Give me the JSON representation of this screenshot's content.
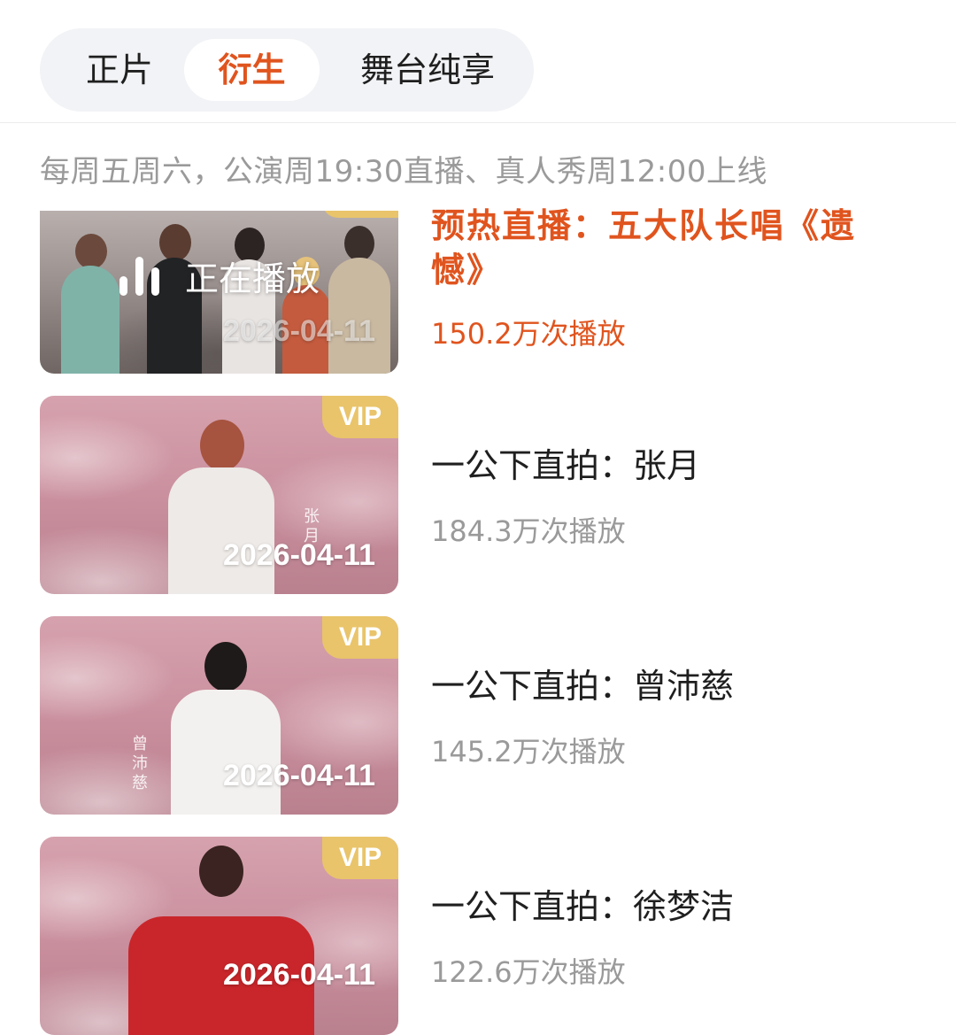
{
  "tabs": [
    {
      "label": "正片",
      "selected": false
    },
    {
      "label": "衍生",
      "selected": true
    },
    {
      "label": "舞台纯享",
      "selected": false
    }
  ],
  "colors": {
    "accent": "#e0541e",
    "vip": "#e9c46a",
    "muted": "#9a9a9a",
    "tab_bg": "#f2f3f6"
  },
  "schedule_note": "每周五周六，公演周19:30直播、真人秀周12:00上线",
  "videos": [
    {
      "title": "预热直播：五大队长唱《遗憾》",
      "plays": "150.2万次播放",
      "date": "2026-04-11",
      "status": "正在播放",
      "status_icon": "playing-bars-icon",
      "vip": false,
      "active": true
    },
    {
      "title": "一公下直拍：张月",
      "plays": "184.3万次播放",
      "date": "2026-04-11",
      "badge": "VIP",
      "thumb_text": "张月",
      "vip": true,
      "active": false
    },
    {
      "title": "一公下直拍：曾沛慈",
      "plays": "145.2万次播放",
      "date": "2026-04-11",
      "badge": "VIP",
      "thumb_text": "曾沛慈",
      "vip": true,
      "active": false
    },
    {
      "title": "一公下直拍：徐梦洁",
      "plays": "122.6万次播放",
      "date": "2026-04-11",
      "badge": "VIP",
      "thumb_text": "",
      "vip": true,
      "active": false
    }
  ]
}
